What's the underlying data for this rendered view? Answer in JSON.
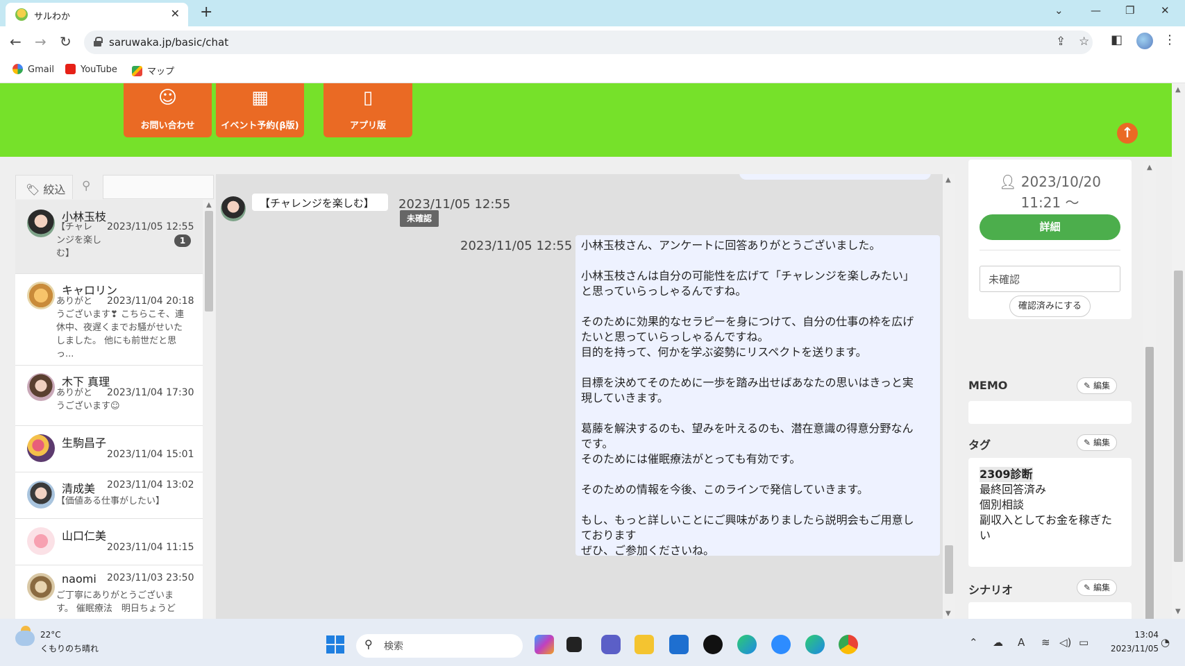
{
  "browser": {
    "tab_title": "サルわか",
    "url": "saruwaka.jp/basic/chat",
    "bookmarks": [
      "Gmail",
      "YouTube",
      "マップ"
    ]
  },
  "site_nav": {
    "buttons": [
      {
        "label": "お問い合わせ",
        "icon": "headset-icon"
      },
      {
        "label": "イベント予約(β版)",
        "icon": "calendar-icon"
      },
      {
        "label": "アプリ版",
        "icon": "smartphone-icon"
      }
    ],
    "accent": "#76e12a",
    "button_color": "#ea6a24"
  },
  "left_panel": {
    "filter_label": "絞込",
    "conversations": [
      {
        "name": "小林玉枝",
        "preview": [
          "【チャレ",
          "ンジを楽し",
          "む】"
        ],
        "date": "2023/11/05 12:55",
        "unread": "1",
        "selected": true
      },
      {
        "name": "キャロリン",
        "preview": [
          "ありがと",
          "うございます❣ こちらこそ、連",
          "休中、夜遅くまでお騒がせいた",
          "しました。 他にも前世だと思",
          "っ..."
        ],
        "date": "2023/11/04 20:18"
      },
      {
        "name": "木下 真理",
        "preview": [
          "ありがと",
          "うございます☺"
        ],
        "date": "2023/11/04 17:30"
      },
      {
        "name": "生駒昌子",
        "preview": [],
        "date": "2023/11/04 15:01"
      },
      {
        "name": "清成美",
        "preview": [
          "【価値ある仕事がしたい】"
        ],
        "date": "2023/11/04 13:02"
      },
      {
        "name": "山口仁美",
        "preview": [],
        "date": "2023/11/04 11:15"
      },
      {
        "name": "naomi",
        "preview": [
          "ご丁寧にありがとうございま",
          "す。 催眠療法　明日ちょうど"
        ],
        "date": "2023/11/03 23:50"
      }
    ]
  },
  "chat": {
    "incoming": {
      "text": "【チャレンジを楽しむ】",
      "date": "2023/11/05 12:55",
      "status": "未確認"
    },
    "outgoing": {
      "date": "2023/11/05 12:55",
      "lines": [
        "小林玉枝さん、アンケートに回答ありがとうございました。",
        "",
        "小林玉枝さんは自分の可能性を広げて「チャレンジを楽しみたい」",
        "と思っていらっしゃるんですね。",
        "",
        "そのために効果的なセラピーを身につけて、自分の仕事の枠を広げ",
        "たいと思っていらっしゃるんですね。",
        "目的を持って、何かを学ぶ姿勢にリスペクトを送ります。",
        "",
        "目標を決めてそのために一歩を踏み出せばあなたの思いはきっと実",
        "現していきます。",
        "",
        "葛藤を解決するのも、望みを叶えるのも、潜在意識の得意分野なん",
        "です。",
        "そのためには催眠療法がとっても有効です。",
        "",
        "そのための情報を今後、このラインで発信していきます。",
        "",
        "もし、もっと詳しいことにご興味がありましたら説明会もご用意し",
        "ております",
        "ぜひ、ご参加くださいね。"
      ]
    }
  },
  "right_panel": {
    "registered_date": "2023/10/20",
    "registered_time": "11:21 〜",
    "detail_button": "詳細",
    "status_value": "未確認",
    "confirm_button": "確認済みにする",
    "memo_heading": "MEMO",
    "tag_heading": "タグ",
    "scenario_heading": "シナリオ",
    "edit_label": "編集",
    "tags": [
      "2309診断",
      "最終回答済み",
      "個別相談",
      "副収入としてお金を稼ぎた",
      "い"
    ]
  },
  "taskbar": {
    "temperature": "22°C",
    "weather": "くもりのち晴れ",
    "search_placeholder": "検索",
    "time": "13:04",
    "date": "2023/11/05"
  }
}
